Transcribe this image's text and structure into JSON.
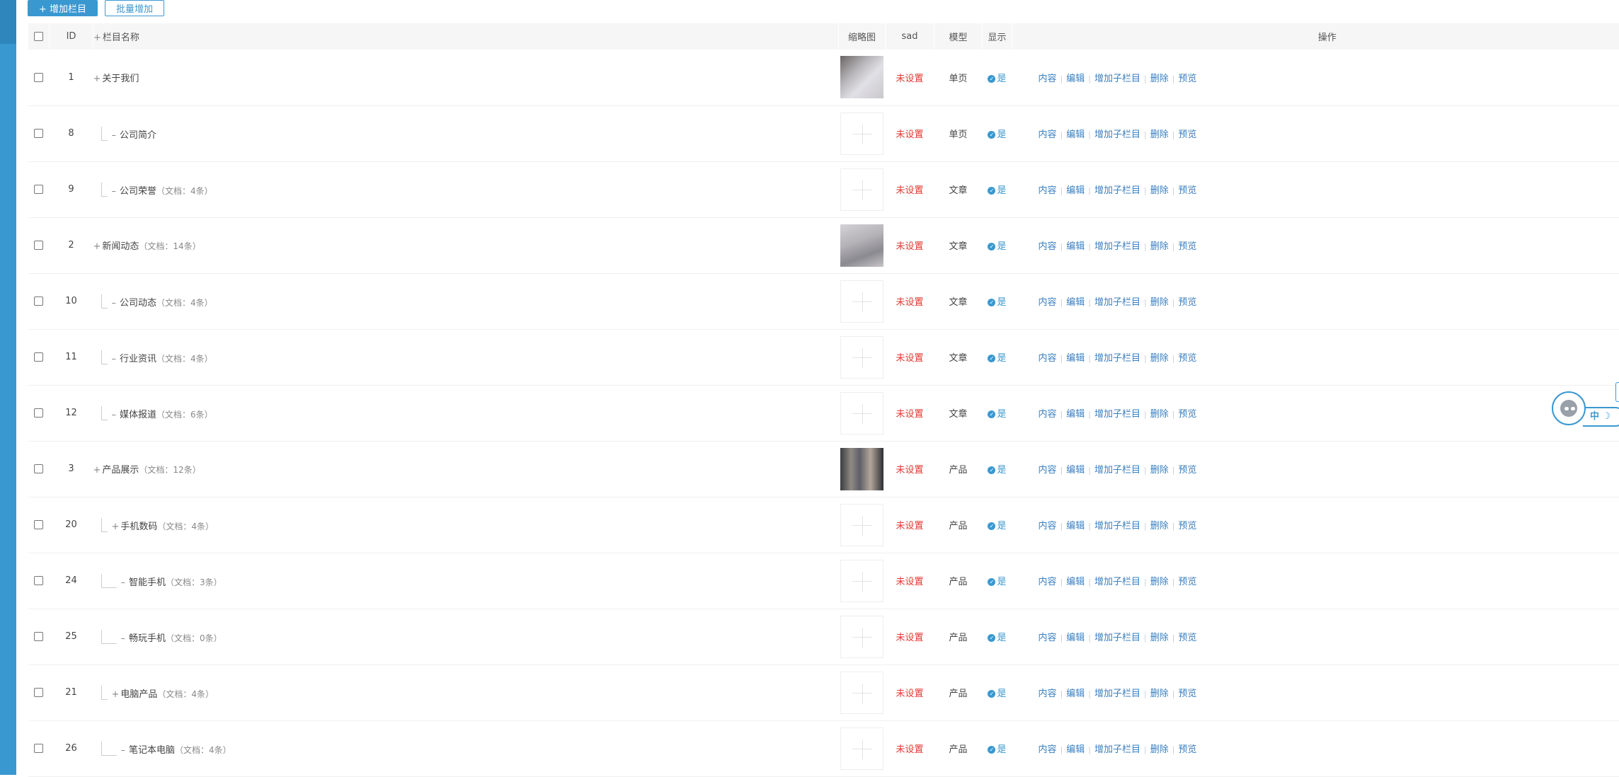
{
  "toolbar": {
    "add_label": "+ 增加栏目",
    "batch_label": "批量增加"
  },
  "header": {
    "id": "ID",
    "name": "栏目名称",
    "thumb": "缩略图",
    "sad": "sad",
    "model": "模型",
    "show": "显示",
    "ops": "操作"
  },
  "ops": {
    "content": "内容",
    "edit": "编辑",
    "add_child": "增加子栏目",
    "delete": "删除",
    "preview": "预览"
  },
  "rows": [
    {
      "id": "1",
      "name": "关于我们",
      "docs": "",
      "level": 0,
      "expand": "+",
      "thumb": "photo1",
      "sad": "未设置",
      "model": "单页",
      "show": "是"
    },
    {
      "id": "8",
      "name": "公司简介",
      "docs": "",
      "level": 1,
      "expand": "–",
      "thumb": "empty",
      "sad": "未设置",
      "model": "单页",
      "show": "是"
    },
    {
      "id": "9",
      "name": "公司荣誉",
      "docs": "（文档：4条）",
      "level": 1,
      "expand": "–",
      "thumb": "empty",
      "sad": "未设置",
      "model": "文章",
      "show": "是"
    },
    {
      "id": "2",
      "name": "新闻动态",
      "docs": "（文档：14条）",
      "level": 0,
      "expand": "+",
      "thumb": "photo2",
      "sad": "未设置",
      "model": "文章",
      "show": "是"
    },
    {
      "id": "10",
      "name": "公司动态",
      "docs": "（文档：4条）",
      "level": 1,
      "expand": "–",
      "thumb": "empty",
      "sad": "未设置",
      "model": "文章",
      "show": "是"
    },
    {
      "id": "11",
      "name": "行业资讯",
      "docs": "（文档：4条）",
      "level": 1,
      "expand": "–",
      "thumb": "empty",
      "sad": "未设置",
      "model": "文章",
      "show": "是"
    },
    {
      "id": "12",
      "name": "媒体报道",
      "docs": "（文档：6条）",
      "level": 1,
      "expand": "–",
      "thumb": "empty",
      "sad": "未设置",
      "model": "文章",
      "show": "是"
    },
    {
      "id": "3",
      "name": "产品展示",
      "docs": "（文档：12条）",
      "level": 0,
      "expand": "+",
      "thumb": "photo3",
      "sad": "未设置",
      "model": "产品",
      "show": "是"
    },
    {
      "id": "20",
      "name": "手机数码",
      "docs": "（文档：4条）",
      "level": 1,
      "expand": "+",
      "thumb": "empty",
      "sad": "未设置",
      "model": "产品",
      "show": "是"
    },
    {
      "id": "24",
      "name": "智能手机",
      "docs": "（文档：3条）",
      "level": 2,
      "expand": "–",
      "thumb": "empty",
      "sad": "未设置",
      "model": "产品",
      "show": "是"
    },
    {
      "id": "25",
      "name": "畅玩手机",
      "docs": "（文档：0条）",
      "level": 2,
      "expand": "–",
      "thumb": "empty",
      "sad": "未设置",
      "model": "产品",
      "show": "是"
    },
    {
      "id": "21",
      "name": "电脑产品",
      "docs": "（文档：4条）",
      "level": 1,
      "expand": "+",
      "thumb": "empty",
      "sad": "未设置",
      "model": "产品",
      "show": "是"
    },
    {
      "id": "26",
      "name": "笔记本电脑",
      "docs": "（文档：4条）",
      "level": 2,
      "expand": "–",
      "thumb": "empty",
      "sad": "未设置",
      "model": "产品",
      "show": "是"
    }
  ],
  "widget": {
    "lang": "中"
  },
  "colors": {
    "accent": "#3a98d0",
    "unset": "#e53935",
    "link": "#3a7fc0"
  }
}
